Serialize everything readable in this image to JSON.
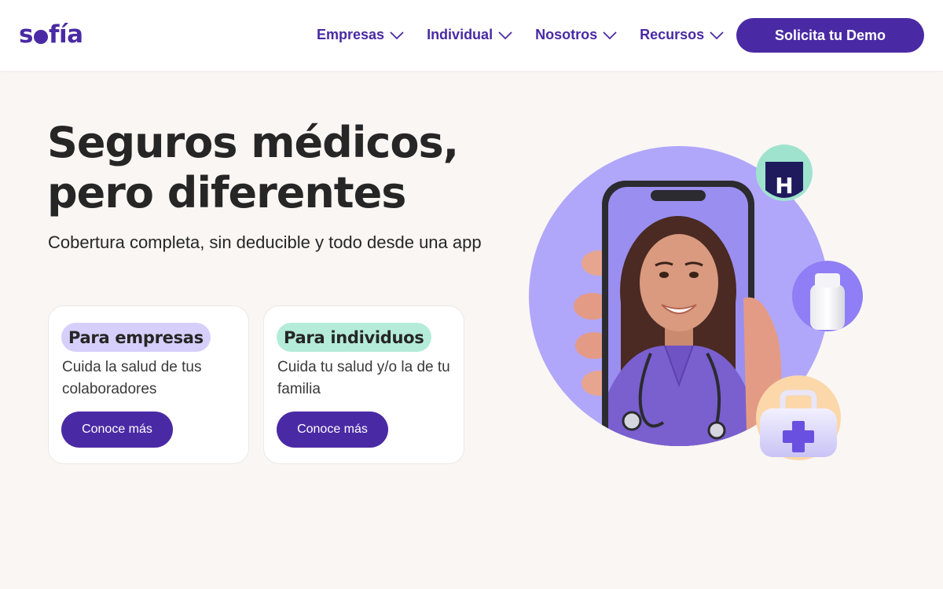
{
  "header": {
    "logo": "sofía",
    "logo_parts": [
      "s",
      "fía"
    ],
    "nav": [
      {
        "label": "Empresas"
      },
      {
        "label": "Individual"
      },
      {
        "label": "Nosotros"
      },
      {
        "label": "Recursos"
      }
    ],
    "cta_label": "Solicita tu Demo"
  },
  "hero": {
    "title_line1": "Seguros médicos,",
    "title_line2": "pero diferentes",
    "subtitle": "Cobertura completa, sin deducible y todo desde una app"
  },
  "cards": [
    {
      "tag": "Para empresas",
      "description": "Cuida la salud de tus colaboradores",
      "button": "Conoce más"
    },
    {
      "tag": "Para individuos",
      "description": "Cuida tu salud y/o la de tu familia",
      "button": "Conoce más"
    }
  ],
  "illustration": {
    "hospital_badge_letter": "H",
    "icons": [
      "hospital-icon",
      "pill-bottle-icon",
      "first-aid-kit-icon"
    ]
  },
  "colors": {
    "brand": "#4a2aa4",
    "background": "#faf6f3",
    "tag_purple": "#d7cffb",
    "tag_green": "#b4ecd9",
    "circle": "#b0a7fb"
  }
}
